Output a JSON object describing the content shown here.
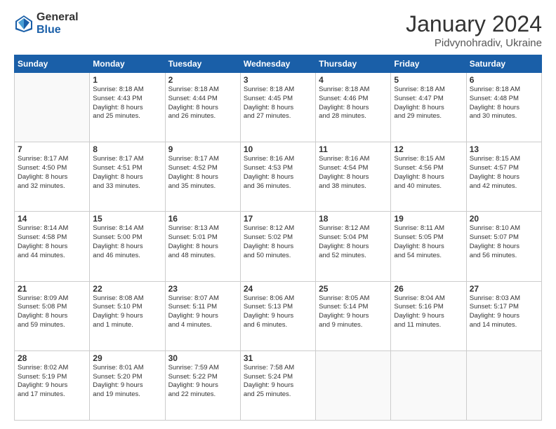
{
  "logo": {
    "general": "General",
    "blue": "Blue"
  },
  "title": "January 2024",
  "location": "Pidvynohradiv, Ukraine",
  "days_of_week": [
    "Sunday",
    "Monday",
    "Tuesday",
    "Wednesday",
    "Thursday",
    "Friday",
    "Saturday"
  ],
  "weeks": [
    [
      {
        "day": "",
        "info": ""
      },
      {
        "day": "1",
        "info": "Sunrise: 8:18 AM\nSunset: 4:43 PM\nDaylight: 8 hours\nand 25 minutes."
      },
      {
        "day": "2",
        "info": "Sunrise: 8:18 AM\nSunset: 4:44 PM\nDaylight: 8 hours\nand 26 minutes."
      },
      {
        "day": "3",
        "info": "Sunrise: 8:18 AM\nSunset: 4:45 PM\nDaylight: 8 hours\nand 27 minutes."
      },
      {
        "day": "4",
        "info": "Sunrise: 8:18 AM\nSunset: 4:46 PM\nDaylight: 8 hours\nand 28 minutes."
      },
      {
        "day": "5",
        "info": "Sunrise: 8:18 AM\nSunset: 4:47 PM\nDaylight: 8 hours\nand 29 minutes."
      },
      {
        "day": "6",
        "info": "Sunrise: 8:18 AM\nSunset: 4:48 PM\nDaylight: 8 hours\nand 30 minutes."
      }
    ],
    [
      {
        "day": "7",
        "info": "Sunrise: 8:17 AM\nSunset: 4:50 PM\nDaylight: 8 hours\nand 32 minutes."
      },
      {
        "day": "8",
        "info": "Sunrise: 8:17 AM\nSunset: 4:51 PM\nDaylight: 8 hours\nand 33 minutes."
      },
      {
        "day": "9",
        "info": "Sunrise: 8:17 AM\nSunset: 4:52 PM\nDaylight: 8 hours\nand 35 minutes."
      },
      {
        "day": "10",
        "info": "Sunrise: 8:16 AM\nSunset: 4:53 PM\nDaylight: 8 hours\nand 36 minutes."
      },
      {
        "day": "11",
        "info": "Sunrise: 8:16 AM\nSunset: 4:54 PM\nDaylight: 8 hours\nand 38 minutes."
      },
      {
        "day": "12",
        "info": "Sunrise: 8:15 AM\nSunset: 4:56 PM\nDaylight: 8 hours\nand 40 minutes."
      },
      {
        "day": "13",
        "info": "Sunrise: 8:15 AM\nSunset: 4:57 PM\nDaylight: 8 hours\nand 42 minutes."
      }
    ],
    [
      {
        "day": "14",
        "info": "Sunrise: 8:14 AM\nSunset: 4:58 PM\nDaylight: 8 hours\nand 44 minutes."
      },
      {
        "day": "15",
        "info": "Sunrise: 8:14 AM\nSunset: 5:00 PM\nDaylight: 8 hours\nand 46 minutes."
      },
      {
        "day": "16",
        "info": "Sunrise: 8:13 AM\nSunset: 5:01 PM\nDaylight: 8 hours\nand 48 minutes."
      },
      {
        "day": "17",
        "info": "Sunrise: 8:12 AM\nSunset: 5:02 PM\nDaylight: 8 hours\nand 50 minutes."
      },
      {
        "day": "18",
        "info": "Sunrise: 8:12 AM\nSunset: 5:04 PM\nDaylight: 8 hours\nand 52 minutes."
      },
      {
        "day": "19",
        "info": "Sunrise: 8:11 AM\nSunset: 5:05 PM\nDaylight: 8 hours\nand 54 minutes."
      },
      {
        "day": "20",
        "info": "Sunrise: 8:10 AM\nSunset: 5:07 PM\nDaylight: 8 hours\nand 56 minutes."
      }
    ],
    [
      {
        "day": "21",
        "info": "Sunrise: 8:09 AM\nSunset: 5:08 PM\nDaylight: 8 hours\nand 59 minutes."
      },
      {
        "day": "22",
        "info": "Sunrise: 8:08 AM\nSunset: 5:10 PM\nDaylight: 9 hours\nand 1 minute."
      },
      {
        "day": "23",
        "info": "Sunrise: 8:07 AM\nSunset: 5:11 PM\nDaylight: 9 hours\nand 4 minutes."
      },
      {
        "day": "24",
        "info": "Sunrise: 8:06 AM\nSunset: 5:13 PM\nDaylight: 9 hours\nand 6 minutes."
      },
      {
        "day": "25",
        "info": "Sunrise: 8:05 AM\nSunset: 5:14 PM\nDaylight: 9 hours\nand 9 minutes."
      },
      {
        "day": "26",
        "info": "Sunrise: 8:04 AM\nSunset: 5:16 PM\nDaylight: 9 hours\nand 11 minutes."
      },
      {
        "day": "27",
        "info": "Sunrise: 8:03 AM\nSunset: 5:17 PM\nDaylight: 9 hours\nand 14 minutes."
      }
    ],
    [
      {
        "day": "28",
        "info": "Sunrise: 8:02 AM\nSunset: 5:19 PM\nDaylight: 9 hours\nand 17 minutes."
      },
      {
        "day": "29",
        "info": "Sunrise: 8:01 AM\nSunset: 5:20 PM\nDaylight: 9 hours\nand 19 minutes."
      },
      {
        "day": "30",
        "info": "Sunrise: 7:59 AM\nSunset: 5:22 PM\nDaylight: 9 hours\nand 22 minutes."
      },
      {
        "day": "31",
        "info": "Sunrise: 7:58 AM\nSunset: 5:24 PM\nDaylight: 9 hours\nand 25 minutes."
      },
      {
        "day": "",
        "info": ""
      },
      {
        "day": "",
        "info": ""
      },
      {
        "day": "",
        "info": ""
      }
    ]
  ]
}
